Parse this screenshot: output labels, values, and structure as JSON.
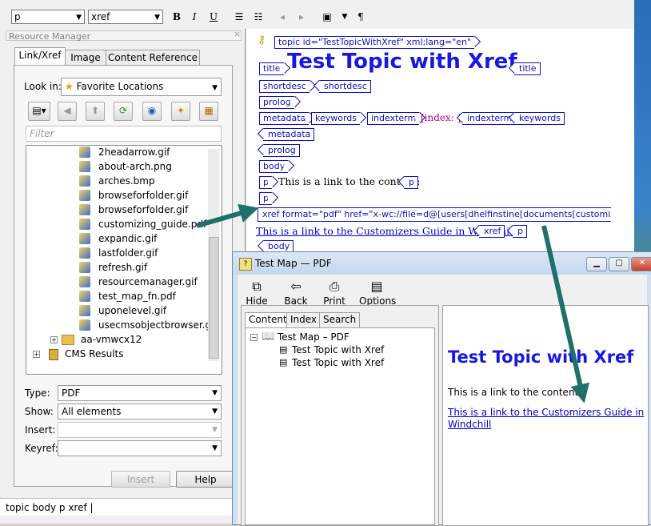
{
  "toolbar": {
    "style_combo": "p",
    "element_combo": "xref",
    "bold": "B",
    "italic": "I",
    "underline": "U",
    "pilcrow": "¶"
  },
  "resource_manager": {
    "title": "Resource Manager",
    "close": "×",
    "tabs": [
      "Link/Xref",
      "Image",
      "Content Reference"
    ],
    "look_in_label": "Look in:",
    "look_in_value": "Favorite Locations",
    "filter_placeholder": "Filter",
    "tree": {
      "files": [
        "2headarrow.gif",
        "about-arch.png",
        "arches.bmp",
        "browseforfolder.gif",
        "browseforfolder.gif",
        "customizing_guide.pdf",
        "expandic.gif",
        "lastfolder.gif",
        "refresh.gif",
        "resourcemanager.gif",
        "test_map_fn.pdf",
        "uponelevel.gif",
        "usecmsobjectbrowser.gif"
      ],
      "folder": "aa-vmwcx12",
      "results": "CMS Results"
    },
    "type_label": "Type:",
    "type_value": "PDF",
    "show_label": "Show:",
    "show_value": "All elements",
    "insert_label": "Insert:",
    "insert_value": "",
    "keyref_label": "Keyref:",
    "keyref_value": "",
    "insert_button": "Insert",
    "help_button": "Help",
    "status": "topic body p xref |"
  },
  "editor": {
    "topic_tag": "topic id=\"TestTopicWithXref\" xml:lang=\"en\"",
    "title_tag": "title",
    "title_text": "Test Topic with Xref",
    "shortdesc": "shortdesc",
    "prolog": "prolog",
    "metadata": "metadata",
    "keywords": "keywords",
    "indexterm": "indexterm",
    "index_text": "[index: ]",
    "body": "body",
    "p": "p",
    "para_text": "This is a link to the content:",
    "xref_tag": "xref format=\"pdf\" href=\"x-wc://file=d@[users[dhelfinstine[documents[customizing_guide.pdf",
    "xref_close": "xref",
    "link_text": "This is a link to the Customizers Guide in Windchill"
  },
  "map_window": {
    "title": "Test Map — PDF",
    "tools": [
      "Hide",
      "Back",
      "Print",
      "Options"
    ],
    "nav_tabs": [
      "Contents",
      "Index",
      "Search"
    ],
    "toc_root": "Test Map – PDF",
    "toc_items": [
      "Test Topic with Xref",
      "Test Topic with Xref"
    ],
    "content_heading": "Test Topic with Xref",
    "content_para": "This is a link to the content:",
    "content_link": "This is a link to the Customizers Guide in Windchill"
  },
  "colors": {
    "tag_blue": "#1010c0",
    "title_blue": "#1818e0",
    "link_blue": "#0000cc",
    "arrow_teal": "#1f6f6a",
    "index_magenta": "#c0008a"
  }
}
